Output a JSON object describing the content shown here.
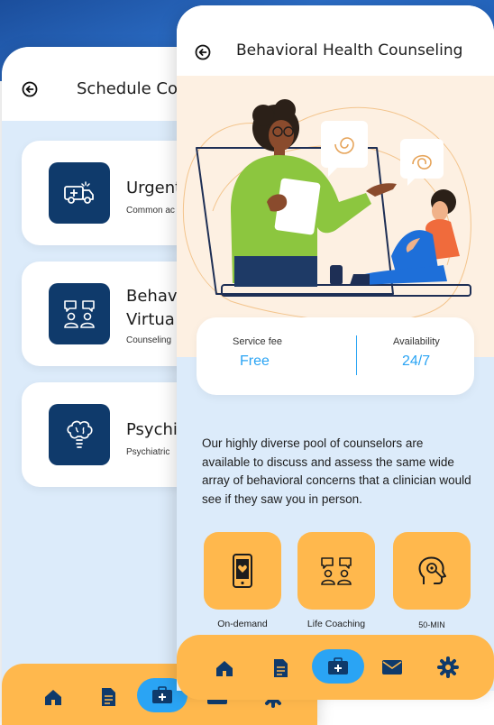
{
  "back_screen": {
    "title": "Schedule Cor",
    "services": [
      {
        "title": "Urgent",
        "subtitle": "Common ac",
        "icon": "ambulance-icon"
      },
      {
        "title_line1": "Behav",
        "title_line2": "Virtua",
        "subtitle": "Counseling",
        "icon": "people-chat-icon"
      },
      {
        "title": "Psychi",
        "subtitle": "Psychiatric",
        "icon": "brain-icon"
      }
    ]
  },
  "front_screen": {
    "title": "Behavioral Health Counseling",
    "info": {
      "fee_label": "Service fee",
      "fee_value": "Free",
      "availability_label": "Availability",
      "availability_value": "24/7"
    },
    "description": "Our highly diverse pool of counselors are available to discuss and assess the same wide array of behavioral concerns that a clinician would see if they saw you in person.",
    "features": [
      {
        "label": "On-demand",
        "icon": "phone-heart-icon"
      },
      {
        "label": "Life Coaching",
        "icon": "people-chat-icon"
      },
      {
        "label": "50-MIN",
        "icon": "head-mind-icon"
      }
    ]
  },
  "nav": {
    "items": [
      "home-icon",
      "document-icon",
      "medical-kit-icon",
      "mail-icon",
      "gear-icon"
    ],
    "active_index": 2
  },
  "colors": {
    "accent_orange": "#ffb84d",
    "accent_blue": "#2aa4f4",
    "navy": "#0f3a6b",
    "light_blue_bg": "#dcebfa",
    "cream_bg": "#fdf0e2"
  }
}
